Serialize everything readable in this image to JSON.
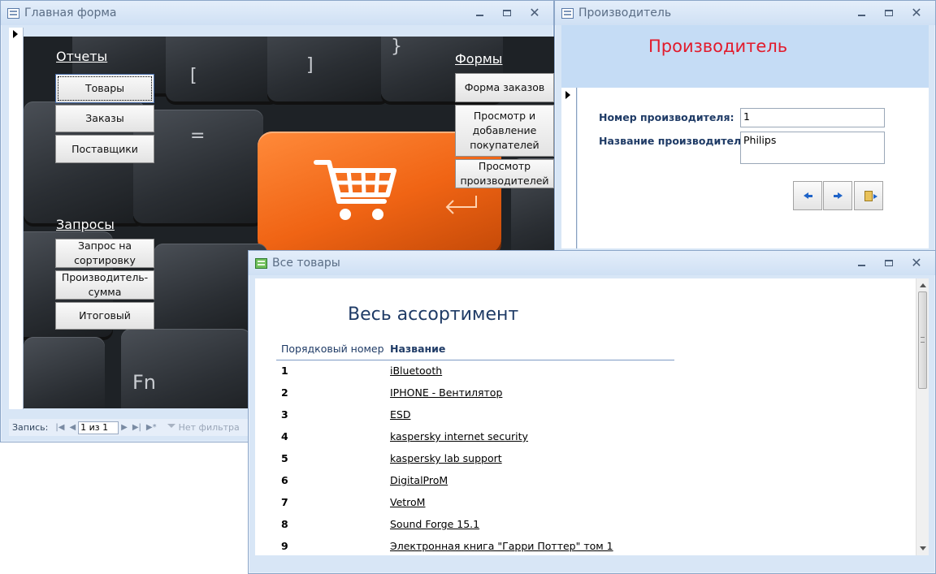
{
  "main_window": {
    "title": "Главная форма",
    "sections": {
      "reports": "Отчеты",
      "forms": "Формы",
      "queries": "Запросы"
    },
    "reports_buttons": [
      "Товары",
      "Заказы",
      "Поставщики"
    ],
    "forms_buttons": [
      "Форма заказов",
      "Просмотр и добавление покупателей",
      "Просмотр производителей"
    ],
    "queries_buttons": [
      "Запрос на сортировку",
      "Производитель-сумма",
      "Итоговый"
    ],
    "statusbar": {
      "label": "Запись:",
      "current": "1 из 1",
      "filter": "Нет фильтра"
    },
    "keyboard": {
      "keys": [
        "]",
        "}",
        "[",
        "=",
        "Fn",
        "~"
      ]
    }
  },
  "manufacturer_window": {
    "title": "Производитель",
    "header": "Производитель",
    "fields": {
      "number_label": "Номер производителя:",
      "number_value": "1",
      "name_label": "Название производителя:",
      "name_value": "Philips"
    }
  },
  "products_window": {
    "title": "Все товары",
    "heading": "Весь ассортимент",
    "columns": [
      "Порядковый номер",
      "Название"
    ],
    "rows": [
      {
        "num": "1",
        "name": "iBluetooth"
      },
      {
        "num": "2",
        "name": "IPHONE - Вентилятор"
      },
      {
        "num": "3",
        "name": "ESD"
      },
      {
        "num": "4",
        "name": "kaspersky internet security"
      },
      {
        "num": "5",
        "name": "kaspersky lab support"
      },
      {
        "num": "6",
        "name": "DigitalProM"
      },
      {
        "num": "7",
        "name": "VetroM"
      },
      {
        "num": "8",
        "name": "Sound Forge 15.1"
      },
      {
        "num": "9",
        "name": "Электронная книга \"Гарри Поттер\" том 1"
      }
    ]
  },
  "colors": {
    "chrome": "#d8e6f6",
    "header_blue": "#c5dcf5",
    "title_red": "#e21b2c",
    "label_blue": "#1f3b66",
    "orange_key": "#f06414"
  }
}
